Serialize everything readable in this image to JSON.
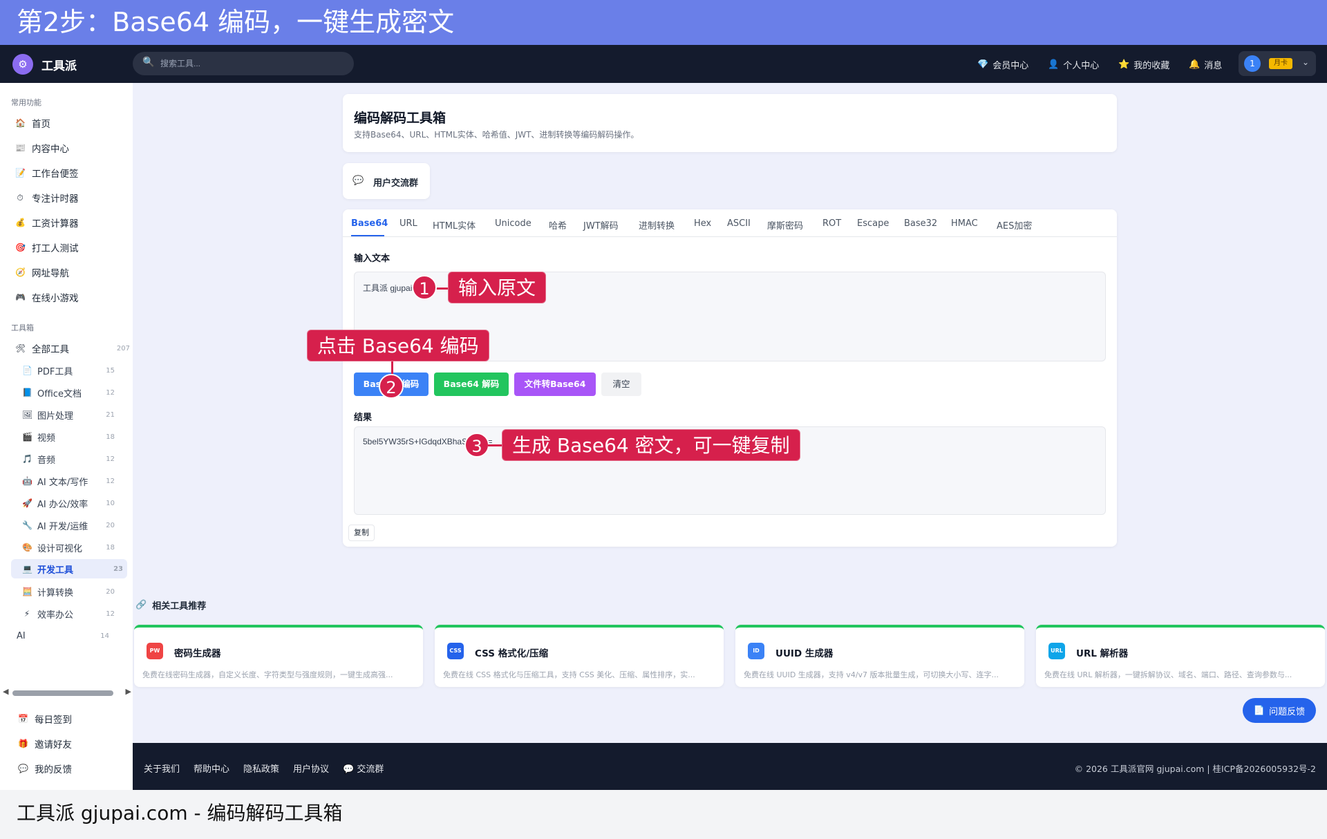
{
  "step_banner": "第2步：Base64 编码，一键生成密文",
  "topnav": {
    "logo_icon": "toolbox-icon",
    "app_title": "工具派",
    "search_placeholder": "搜索工具...",
    "links": [
      {
        "icon": "💎",
        "label": "会员中心"
      },
      {
        "icon": "👤",
        "label": "个人中心"
      },
      {
        "icon": "⭐",
        "label": "我的收藏"
      },
      {
        "icon": "🔔",
        "label": "消息"
      }
    ],
    "avatar_text": "1",
    "vip_badge": "月卡"
  },
  "sidebar": {
    "common_title": "常用功能",
    "common_items": [
      {
        "icon": "🏠",
        "label": "首页"
      },
      {
        "icon": "📰",
        "label": "内容中心"
      },
      {
        "icon": "📝",
        "label": "工作台便签"
      },
      {
        "icon": "⏱",
        "label": "专注计时器"
      },
      {
        "icon": "💰",
        "label": "工资计算器"
      },
      {
        "icon": "🎯",
        "label": "打工人测试"
      },
      {
        "icon": "🧭",
        "label": "网址导航"
      },
      {
        "icon": "🎮",
        "label": "在线小游戏"
      }
    ],
    "toolbox_title": "工具箱",
    "all_tools": {
      "icon": "🛠",
      "label": "全部工具",
      "count": "207"
    },
    "categories": [
      {
        "icon": "📄",
        "label": "PDF工具",
        "count": "15"
      },
      {
        "icon": "📘",
        "label": "Office文档",
        "count": "12"
      },
      {
        "icon": "🖼",
        "label": "图片处理",
        "count": "21"
      },
      {
        "icon": "🎬",
        "label": "视频",
        "count": "18"
      },
      {
        "icon": "🎵",
        "label": "音频",
        "count": "12"
      },
      {
        "icon": "🤖",
        "label": "AI 文本/写作",
        "count": "12"
      },
      {
        "icon": "🚀",
        "label": "AI 办公/效率",
        "count": "10"
      },
      {
        "icon": "🔧",
        "label": "AI 开发/运维",
        "count": "20"
      },
      {
        "icon": "🎨",
        "label": "设计可视化",
        "count": "18"
      },
      {
        "icon": "💻",
        "label": "开发工具",
        "count": "23"
      },
      {
        "icon": "🧮",
        "label": "计算转换",
        "count": "20"
      },
      {
        "icon": "⚡",
        "label": "效率办公",
        "count": "12"
      },
      {
        "icon": "",
        "label": "AI",
        "count": "14"
      }
    ],
    "bottom_items": [
      {
        "icon": "📅",
        "label": "每日签到"
      },
      {
        "icon": "🎁",
        "label": "邀请好友"
      },
      {
        "icon": "💬",
        "label": "我的反馈"
      }
    ]
  },
  "header_card": {
    "title": "编码解码工具箱",
    "subtitle": "支持Base64、URL、HTML实体、哈希值、JWT、进制转换等编码解码操作。"
  },
  "group_card": {
    "icon": "💬",
    "label": "用户交流群"
  },
  "tabs": [
    "Base64",
    "URL",
    "HTML实体",
    "Unicode",
    "哈希",
    "JWT解码",
    "进制转换",
    "Hex",
    "ASCII",
    "摩斯密码",
    "ROT",
    "Escape",
    "Base32",
    "HMAC",
    "AES加密"
  ],
  "input": {
    "label": "输入文本",
    "value": "工具派 gjupai.com"
  },
  "buttons": {
    "encode": "Base64 编码",
    "decode": "Base64 解码",
    "file": "文件转Base64",
    "clear": "清空"
  },
  "result": {
    "label": "结果",
    "value": "5bel5YW35rS+IGdqdXBhaS5jb20=",
    "copy": "复制"
  },
  "annotations": {
    "c1_num": "1",
    "c1_text": "输入原文",
    "c2_num": "2",
    "c2_text": "点击 Base64 编码",
    "c3_num": "3",
    "c3_text": "生成 Base64 密文，可一键复制"
  },
  "related": {
    "title": "相关工具推荐",
    "tools": [
      {
        "badge": "PW",
        "color": "#ef4444",
        "name": "密码生成器",
        "desc": "免费在线密码生成器，自定义长度、字符类型与强度规则，一键生成高强..."
      },
      {
        "badge": "CSS",
        "color": "#2563eb",
        "name": "CSS 格式化/压缩",
        "desc": "免费在线 CSS 格式化与压缩工具，支持 CSS 美化、压缩、属性排序，实..."
      },
      {
        "badge": "ID",
        "color": "#3b82f6",
        "name": "UUID 生成器",
        "desc": "免费在线 UUID 生成器，支持 v4/v7 版本批量生成，可切换大小写、连字..."
      },
      {
        "badge": "URL",
        "color": "#0ea5e9",
        "name": "URL 解析器",
        "desc": "免费在线 URL 解析器，一键拆解协议、域名、端口、路径、查询参数与..."
      }
    ]
  },
  "feedback_button": "问题反馈",
  "footer": {
    "links": [
      "关于我们",
      "帮助中心",
      "隐私政策",
      "用户协议",
      "💬 交流群"
    ],
    "copyright": "© 2026 工具派官网 gjupai.com | 桂ICP备2026005932号-2"
  },
  "bottom_caption": "工具派 gjupai.com - 编码解码工具箱"
}
